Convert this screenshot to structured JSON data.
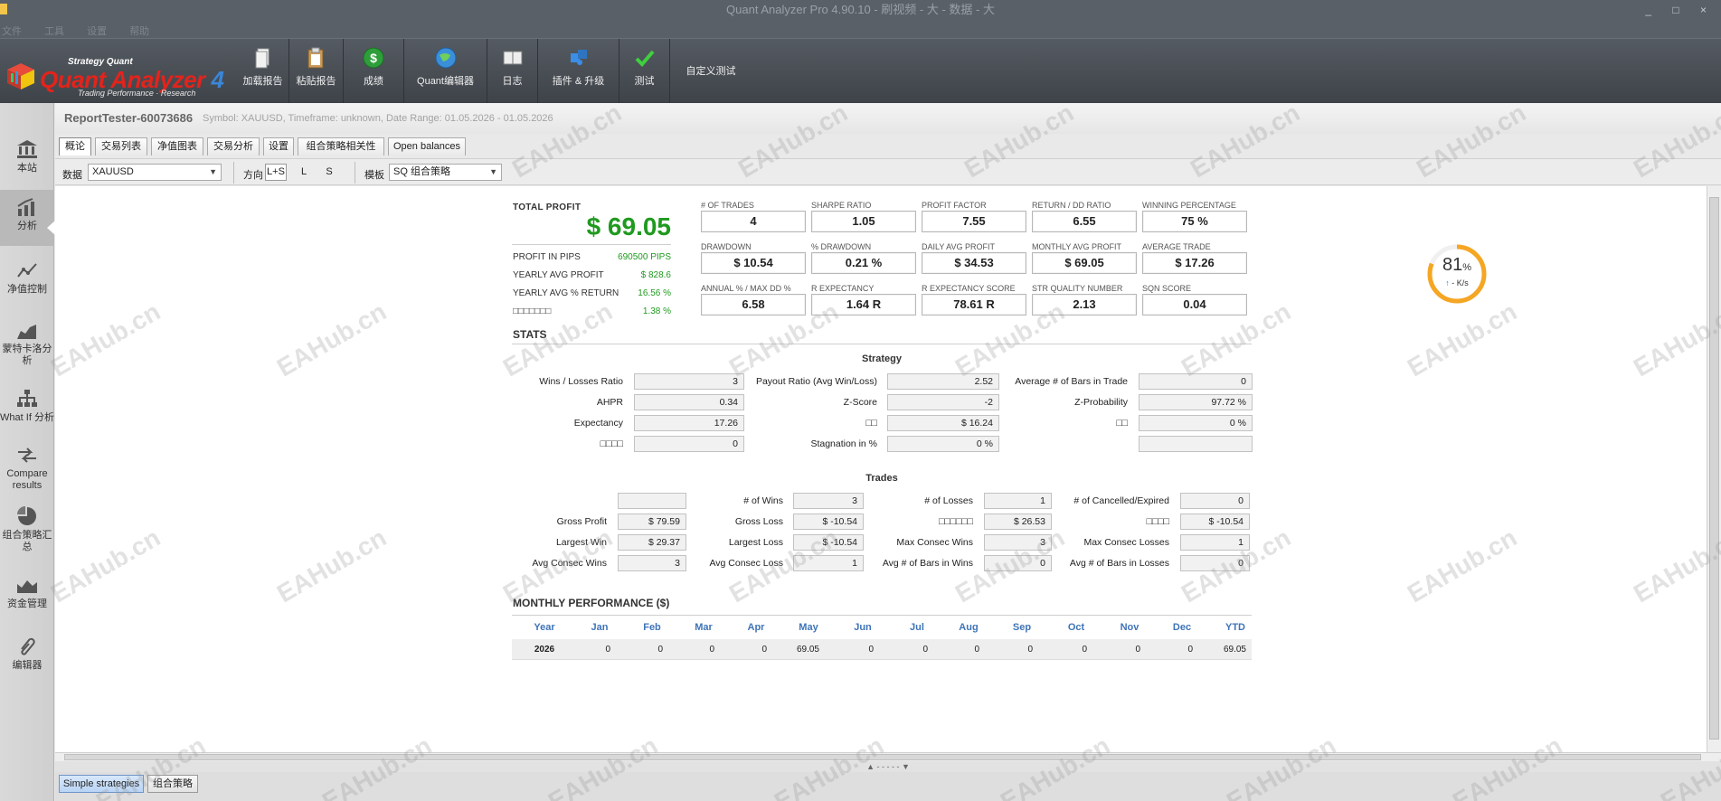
{
  "window": {
    "title": "Quant Analyzer Pro 4.90.10 - 刷视频 - 大 - 数据 - 大",
    "controls": "_ □ ×",
    "menu": [
      "文件",
      "工具",
      "设置",
      "帮助"
    ]
  },
  "logo": {
    "small": "Strategy Quant",
    "big": "Quant Analyzer",
    "version": "4",
    "tagline": "Trading Performance · Research"
  },
  "toolbar": {
    "load_report": "加载报告",
    "paste_report": "粘贴报告",
    "results": "成绩",
    "quant_editor": "Quant编辑器",
    "log": "日志",
    "plugins": "插件 & 升级",
    "test": "测试",
    "custom_test": "自定义测试"
  },
  "sidebar": [
    {
      "label": "本站",
      "icon": "bank-icon"
    },
    {
      "label": "分析",
      "icon": "analysis-chart-icon"
    },
    {
      "label": "净值控制",
      "icon": "equity-line-icon"
    },
    {
      "label": "蒙特卡洛分析",
      "icon": "montecarlo-icon"
    },
    {
      "label": "What If 分析",
      "icon": "hierarchy-icon"
    },
    {
      "label": "Compare results",
      "icon": "compare-arrows-icon"
    },
    {
      "label": "组合策略汇总",
      "icon": "pie-chart-icon"
    },
    {
      "label": "资金管理",
      "icon": "money-management-icon"
    },
    {
      "label": "编辑器",
      "icon": "paperclip-icon"
    }
  ],
  "report": {
    "name": "ReportTester-60073686",
    "info": "Symbol: XAUUSD, Timeframe: unknown, Date Range: 01.05.2026 - 01.05.2026"
  },
  "tabs": [
    "概论",
    "交易列表",
    "净值图表",
    "交易分析",
    "设置",
    "组合策略相关性",
    "Open balances"
  ],
  "filters": {
    "data_label": "数据",
    "data_value": "XAUUSD",
    "direction_label": "方向",
    "directions": [
      "L+S",
      "L",
      "S"
    ],
    "template_label": "模板",
    "template_value": "SQ 组合策略"
  },
  "summary": {
    "total_profit_label": "TOTAL PROFIT",
    "total_profit": "$ 69.05",
    "rows": [
      {
        "label": "PROFIT IN PIPS",
        "value": "690500 PIPS"
      },
      {
        "label": "YEARLY AVG PROFIT",
        "value": "$ 828.6"
      },
      {
        "label": "YEARLY AVG % RETURN",
        "value": "16.56 %"
      },
      {
        "label": "□□□□□□□",
        "value": "1.38 %"
      }
    ],
    "metrics": [
      {
        "label": "# OF TRADES",
        "value": "4"
      },
      {
        "label": "SHARPE RATIO",
        "value": "1.05"
      },
      {
        "label": "PROFIT FACTOR",
        "value": "7.55"
      },
      {
        "label": "RETURN / DD RATIO",
        "value": "6.55"
      },
      {
        "label": "WINNING PERCENTAGE",
        "value": "75 %"
      },
      {
        "label": "DRAWDOWN",
        "value": "$ 10.54"
      },
      {
        "label": "% DRAWDOWN",
        "value": "0.21 %"
      },
      {
        "label": "DAILY AVG PROFIT",
        "value": "$ 34.53"
      },
      {
        "label": "MONTHLY AVG PROFIT",
        "value": "$ 69.05"
      },
      {
        "label": "AVERAGE TRADE",
        "value": "$ 17.26"
      },
      {
        "label": "ANNUAL % / MAX DD %",
        "value": "6.58"
      },
      {
        "label": "R EXPECTANCY",
        "value": "1.64 R"
      },
      {
        "label": "R EXPECTANCY SCORE",
        "value": "78.61 R"
      },
      {
        "label": "STR QUALITY NUMBER",
        "value": "2.13"
      },
      {
        "label": "SQN SCORE",
        "value": "0.04"
      }
    ]
  },
  "gauge": {
    "percent": "81",
    "unit": "%",
    "speed": "- K/s",
    "arrow": "↑",
    "fill": 0.81,
    "color": "#f5a623"
  },
  "stats": {
    "title": "STATS",
    "strategy_title": "Strategy",
    "strategy": [
      [
        {
          "label": "Wins / Losses Ratio",
          "value": "3"
        },
        {
          "label": "Payout Ratio (Avg Win/Loss)",
          "value": "2.52"
        },
        {
          "label": "Average # of Bars in Trade",
          "value": "0"
        }
      ],
      [
        {
          "label": "AHPR",
          "value": "0.34"
        },
        {
          "label": "Z-Score",
          "value": "-2"
        },
        {
          "label": "Z-Probability",
          "value": "97.72 %"
        }
      ],
      [
        {
          "label": "Expectancy",
          "value": "17.26"
        },
        {
          "label": "□□",
          "value": "$ 16.24"
        },
        {
          "label": "□□",
          "value": "0 %"
        }
      ],
      [
        {
          "label": "□□□□",
          "value": "0"
        },
        {
          "label": "Stagnation in %",
          "value": "0 %"
        },
        {
          "label": "",
          "value": ""
        }
      ]
    ],
    "trades_title": "Trades",
    "trades": [
      [
        {
          "label": "",
          "value": ""
        },
        {
          "label": "# of Wins",
          "value": "3"
        },
        {
          "label": "# of Losses",
          "value": "1"
        },
        {
          "label": "# of Cancelled/Expired",
          "value": "0"
        }
      ],
      [
        {
          "label": "Gross Profit",
          "value": "$ 79.59"
        },
        {
          "label": "Gross Loss",
          "value": "$ -10.54"
        },
        {
          "label": "□□□□□□",
          "value": "$ 26.53"
        },
        {
          "label": "□□□□",
          "value": "$ -10.54"
        }
      ],
      [
        {
          "label": "Largest Win",
          "value": "$ 29.37"
        },
        {
          "label": "Largest Loss",
          "value": "$ -10.54"
        },
        {
          "label": "Max Consec Wins",
          "value": "3"
        },
        {
          "label": "Max Consec Losses",
          "value": "1"
        }
      ],
      [
        {
          "label": "Avg Consec Wins",
          "value": "3"
        },
        {
          "label": "Avg Consec Loss",
          "value": "1"
        },
        {
          "label": "Avg # of Bars in Wins",
          "value": "0"
        },
        {
          "label": "Avg # of Bars in Losses",
          "value": "0"
        }
      ]
    ]
  },
  "monthly": {
    "title": "MONTHLY PERFORMANCE ($)",
    "headers": [
      "Year",
      "Jan",
      "Feb",
      "Mar",
      "Apr",
      "May",
      "Jun",
      "Jul",
      "Aug",
      "Sep",
      "Oct",
      "Nov",
      "Dec",
      "YTD"
    ],
    "rows": [
      [
        "2026",
        "0",
        "0",
        "0",
        "0",
        "69.05",
        "0",
        "0",
        "0",
        "0",
        "0",
        "0",
        "0",
        "69.05"
      ]
    ]
  },
  "splitter": "▲ - - - - - ▼",
  "bottom_tabs": [
    "Simple strategies",
    "组合策略"
  ],
  "watermark": "EAHub.cn"
}
